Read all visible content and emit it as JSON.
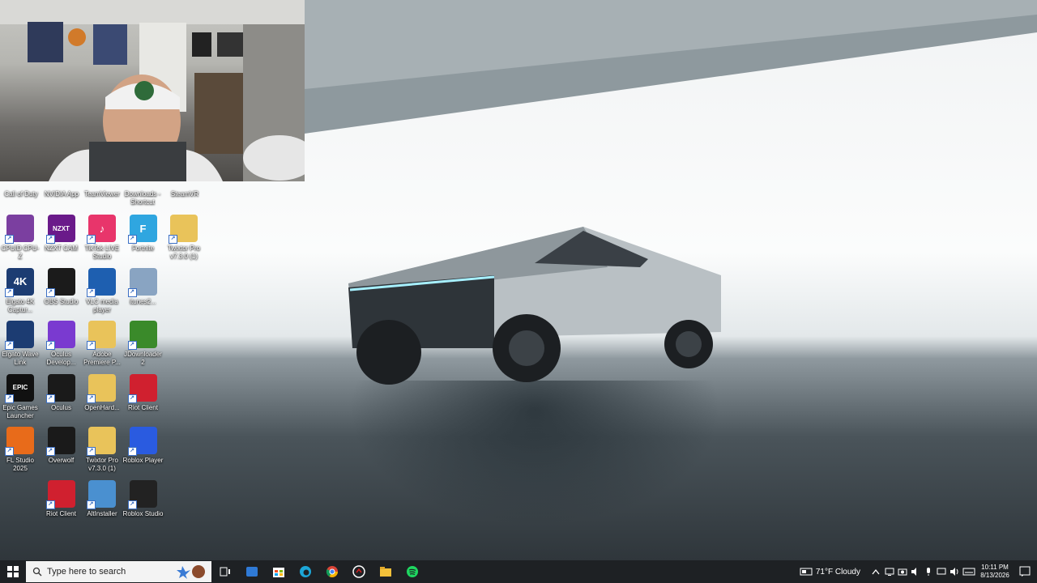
{
  "desktop": {
    "icons_top": [
      {
        "label": "Call of Duty"
      },
      {
        "label": "NVIDIA App"
      },
      {
        "label": "TeamViewer"
      },
      {
        "label": "Downloads - Shortcut"
      },
      {
        "label": "SteamVR"
      }
    ],
    "icons": [
      {
        "label": "CPUID CPU-Z",
        "glyph": "",
        "color": "#7b3fa0",
        "icon": "cpuz-icon"
      },
      {
        "label": "NZXT CAM",
        "glyph": "NZXT",
        "color": "#6a1a8a",
        "icon": "nzxt-cam-icon"
      },
      {
        "label": "TikTok LIVE Studio",
        "glyph": "♪",
        "color": "#e8356b",
        "icon": "tiktok-icon"
      },
      {
        "label": "Fortnite",
        "glyph": "F",
        "color": "#2fa6e0",
        "icon": "fortnite-icon"
      },
      {
        "label": "Twixtor Pro v7.3.0 (1)",
        "glyph": "",
        "color": "#e9c35a",
        "icon": "folder-icon"
      },
      {
        "label": "Elgato 4K Captur...",
        "glyph": "4K",
        "color": "#1c3c72",
        "icon": "elgato-4k-icon"
      },
      {
        "label": "OBS Studio",
        "glyph": "",
        "color": "#1b1b1b",
        "icon": "obs-icon"
      },
      {
        "label": "VLC media player",
        "glyph": "",
        "color": "#1e5fb0",
        "icon": "vlc-icon"
      },
      {
        "label": "itunes2...",
        "glyph": "",
        "color": "#89a4c2",
        "icon": "itunes-icon"
      },
      {
        "label": "Elgato Wave Link",
        "glyph": "",
        "color": "#1c3c72",
        "icon": "wave-link-icon"
      },
      {
        "label": "Oculus Develop...",
        "glyph": "",
        "color": "#7a3ad0",
        "icon": "oculus-dev-icon"
      },
      {
        "label": "Adobe Premiere P...",
        "glyph": "",
        "color": "#e9c35a",
        "icon": "folder-icon"
      },
      {
        "label": "JDownloader 2",
        "glyph": "",
        "color": "#3a8a2a",
        "icon": "jdownloader-icon"
      },
      {
        "label": "Epic Games Launcher",
        "glyph": "EPIC",
        "color": "#111111",
        "icon": "epic-games-icon"
      },
      {
        "label": "Oculus",
        "glyph": "",
        "color": "#1a1a1a",
        "icon": "oculus-icon"
      },
      {
        "label": "OpenHard...",
        "glyph": "",
        "color": "#e9c35a",
        "icon": "folder-icon"
      },
      {
        "label": "Riot Client",
        "glyph": "",
        "color": "#d0202f",
        "icon": "riot-icon"
      },
      {
        "label": "FL Studio 2025",
        "glyph": "",
        "color": "#e86b1a",
        "icon": "fl-studio-icon"
      },
      {
        "label": "Overwolf",
        "glyph": "",
        "color": "#1a1a1a",
        "icon": "overwolf-icon"
      },
      {
        "label": "Twixtor Pro v7.3.0 (1)",
        "glyph": "",
        "color": "#e9c35a",
        "icon": "folder-icon"
      },
      {
        "label": "Roblox Player",
        "glyph": "",
        "color": "#2a5be0",
        "icon": "roblox-player-icon"
      },
      {
        "label": "Riot Client",
        "glyph": "",
        "color": "#d0202f",
        "icon": "riot-icon"
      },
      {
        "label": "AltInstaller",
        "glyph": "",
        "color": "#4a90d0",
        "icon": "installer-icon"
      },
      {
        "label": "Roblox Studio",
        "glyph": "",
        "color": "#222222",
        "icon": "roblox-studio-icon"
      }
    ]
  },
  "taskbar": {
    "search_placeholder": "Type here to search",
    "weather": "71°F  Cloudy",
    "time": "10:11 PM",
    "date": "8/13/2026"
  },
  "colors": {
    "taskbar_bg": "#1e2124",
    "search_bg": "#f3f3f3"
  }
}
